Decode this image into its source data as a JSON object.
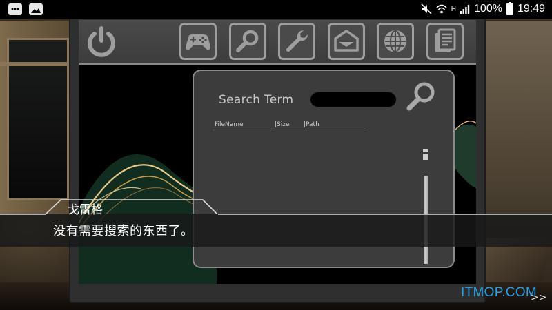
{
  "status_bar": {
    "battery": "100%",
    "time": "19:49",
    "network_type": "H",
    "icons": [
      "messages-icon",
      "gallery-icon",
      "mute-icon",
      "wifi-icon",
      "signal-icon",
      "battery-icon"
    ]
  },
  "toolbar": {
    "buttons": [
      {
        "icon": "power-icon"
      },
      {
        "icon": "gamepad-icon"
      },
      {
        "icon": "search-icon"
      },
      {
        "icon": "wrench-icon"
      },
      {
        "icon": "mail-icon"
      },
      {
        "icon": "globe-icon"
      },
      {
        "icon": "document-icon"
      }
    ]
  },
  "search_panel": {
    "label": "Search Term",
    "input_value": "",
    "columns": {
      "file": "FileName",
      "size": "Size",
      "path": "Path"
    },
    "separator": "|"
  },
  "dialogue": {
    "speaker": "戈雷格",
    "text": "没有需要搜索的东西了。"
  },
  "watermark": "ITMOP.COM",
  "skip_label": ">>",
  "colors": {
    "panel_bg": "#3c3c3c",
    "panel_border": "#8c8c8c",
    "icon_gray": "#9e9e9e",
    "watermark": "#23a0e8"
  }
}
